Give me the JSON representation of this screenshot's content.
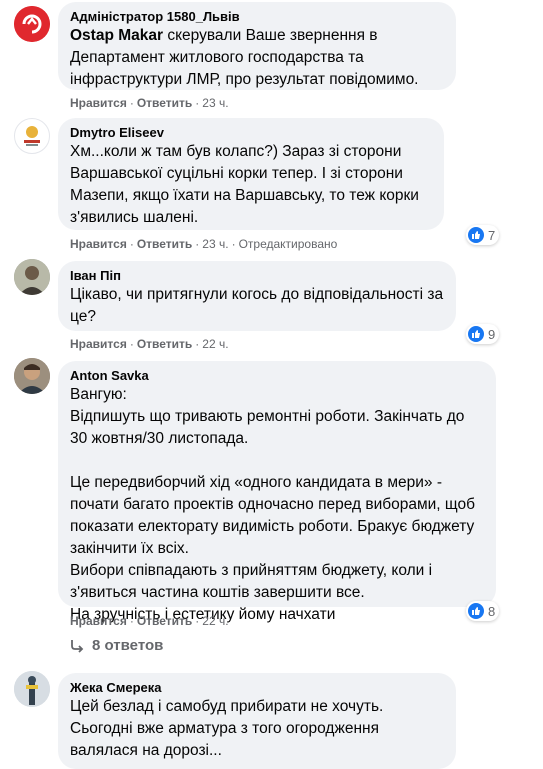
{
  "comments": [
    {
      "author": "Адміністратор 1580_Львів",
      "mention": "Ostap Makar",
      "text": " скерували Ваше звернення в Департамент житлового господарства та інфраструктури ЛМР, про результат повідомимо.",
      "like": "Нравится",
      "reply": "Ответить",
      "time": "23 ч."
    },
    {
      "author": "Dmytro Eliseev",
      "text": "Хм...коли ж там був колапс?) Зараз зі сторони Варшавської суцільні корки тепер. І зі сторони Мазепи, якщо їхати на Варшавську, то теж корки з'явились шалені.",
      "like": "Нравится",
      "reply": "Ответить",
      "time": "23 ч.",
      "edited": "Отредактировано",
      "reactions": "7"
    },
    {
      "author": "Іван Піп",
      "text": "Цікаво, чи притягнули когось до відповідальності за це?",
      "like": "Нравится",
      "reply": "Ответить",
      "time": "22 ч.",
      "reactions": "9"
    },
    {
      "author": "Anton Savka",
      "text": "Вангую:\nВідпишуть що тривають ремонтні роботи. Закінчать до 30 жовтня/30 листопада.\n\nЦе передвиборчий хід «одного кандидата в мери» - почати багато проектів одночасно перед виборами, щоб показати електорату видимість роботи. Бракує бюджету закінчити їх всіх.\nВибори співпадають з прийняттям бюджету, коли і з'явиться частина коштів завершити все.\nНа зручність і естетику йому начхати",
      "like": "Нравится",
      "reply": "Ответить",
      "time": "22 ч.",
      "reactions": "8",
      "replies": "8 ответов"
    },
    {
      "author": "Жека Смерека",
      "text": "Цей безлад і самобуд прибирати не хочуть. Сьогодні вже арматура з того огородження валялася на дорозі..."
    }
  ],
  "colors": {
    "like": "#1877f2",
    "bubble": "#f0f2f5",
    "meta": "#65676b"
  }
}
